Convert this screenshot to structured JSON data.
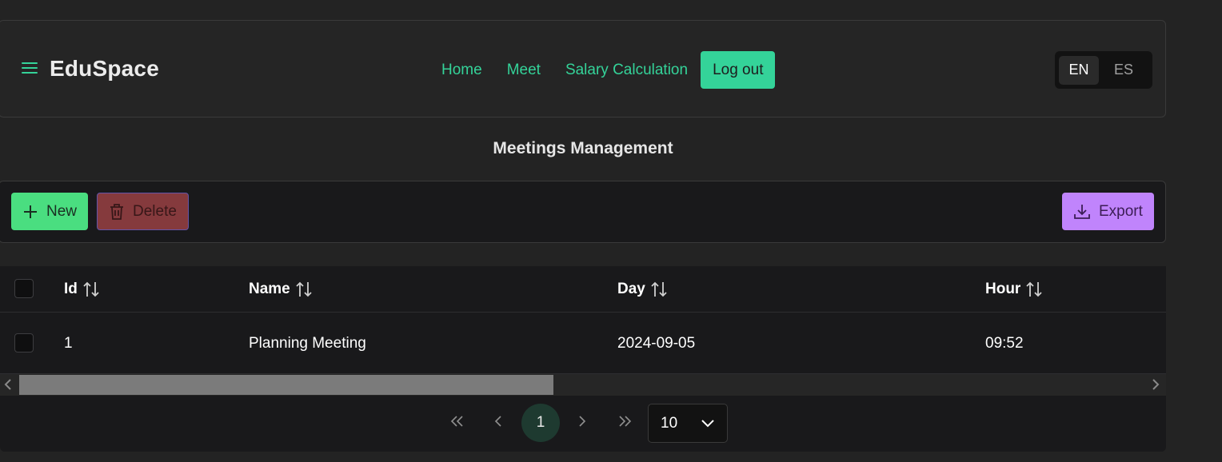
{
  "header": {
    "brand": "EduSpace",
    "nav": [
      {
        "label": "Home"
      },
      {
        "label": "Meet"
      },
      {
        "label": "Salary Calculation"
      }
    ],
    "logout_label": "Log out",
    "languages": [
      {
        "code": "EN",
        "active": true
      },
      {
        "code": "ES",
        "active": false
      }
    ]
  },
  "page": {
    "title": "Meetings Management"
  },
  "toolbar": {
    "new_label": "New",
    "delete_label": "Delete",
    "export_label": "Export"
  },
  "table": {
    "columns": [
      {
        "label": "Id"
      },
      {
        "label": "Name"
      },
      {
        "label": "Day"
      },
      {
        "label": "Hour"
      }
    ],
    "rows": [
      {
        "id": "1",
        "name": "Planning Meeting",
        "day": "2024-09-05",
        "hour": "09:52"
      }
    ]
  },
  "paginator": {
    "current_page": "1",
    "rows_per_page": "10"
  },
  "colors": {
    "accent": "#34d399",
    "new_button": "#4ade80",
    "delete_button": "#8f3d40",
    "export_button": "#c084fc",
    "background": "#232323"
  },
  "icons": [
    "menu-icon",
    "plus-icon",
    "trash-icon",
    "download-icon",
    "sort-icon",
    "chevron-double-left-icon",
    "chevron-left-icon",
    "chevron-right-icon",
    "chevron-double-right-icon",
    "chevron-down-icon"
  ]
}
